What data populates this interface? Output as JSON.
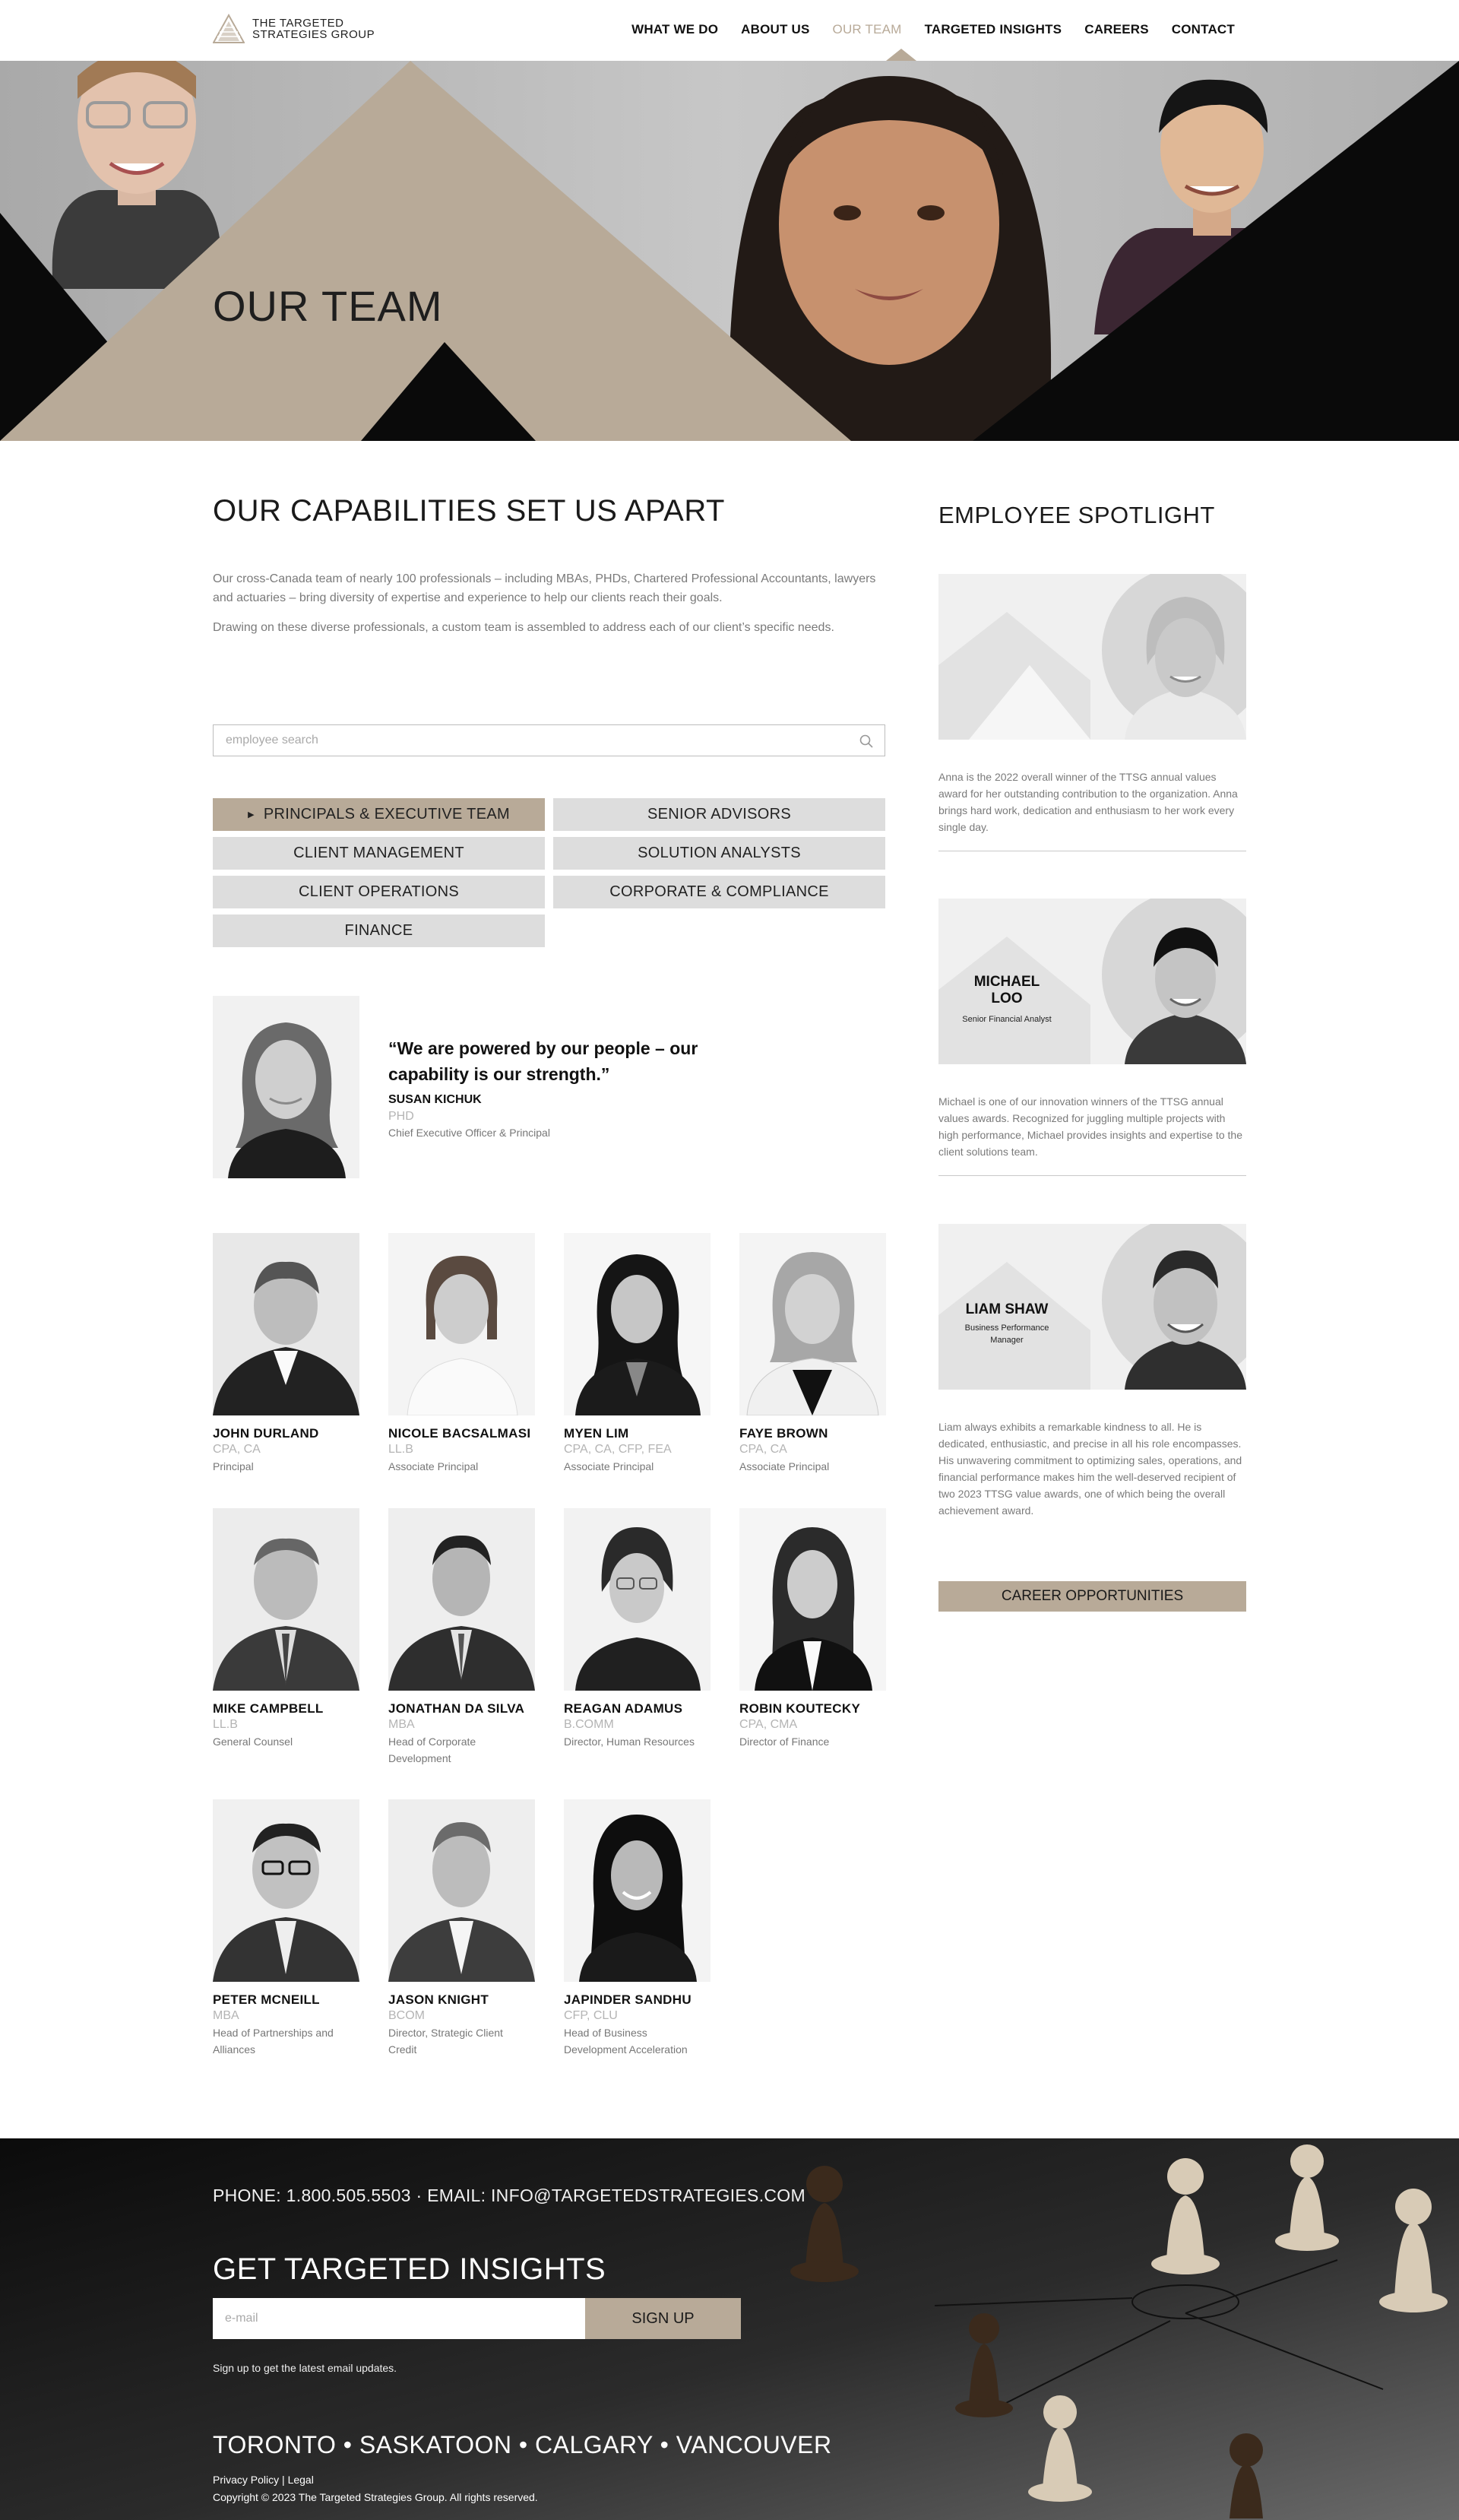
{
  "brand": {
    "name_line1": "THE TARGETED",
    "name_line2": "STRATEGIES GROUP",
    "accent_color": "#b8aa98"
  },
  "nav": {
    "items": [
      {
        "label": "WHAT WE DO",
        "active": false
      },
      {
        "label": "ABOUT US",
        "active": false
      },
      {
        "label": "OUR TEAM",
        "active": true
      },
      {
        "label": "TARGETED INSIGHTS",
        "active": false
      },
      {
        "label": "CAREERS",
        "active": false
      },
      {
        "label": "CONTACT",
        "active": false
      }
    ]
  },
  "hero": {
    "title": "OUR TEAM"
  },
  "main": {
    "title": "OUR CAPABILITIES SET US APART",
    "intro": [
      "Our cross-Canada team of nearly 100 professionals – including MBAs, PHDs, Chartered Professional Accountants, lawyers and actuaries – bring diversity of expertise and experience to help our clients reach their goals.",
      "Drawing on these diverse professionals, a custom team is assembled to address each of our client’s specific needs."
    ],
    "search_placeholder": "employee search",
    "filters": [
      {
        "label": "PRINCIPALS & EXECUTIVE TEAM",
        "active": true
      },
      {
        "label": "SENIOR ADVISORS",
        "active": false
      },
      {
        "label": "CLIENT MANAGEMENT",
        "active": false
      },
      {
        "label": "SOLUTION ANALYSTS",
        "active": false
      },
      {
        "label": "CLIENT OPERATIONS",
        "active": false
      },
      {
        "label": "CORPORATE & COMPLIANCE",
        "active": false
      },
      {
        "label": "FINANCE",
        "active": false
      }
    ],
    "featured": {
      "quote": "“We are powered by our people – our capability is our strength.”",
      "name": "SUSAN KICHUK",
      "credentials": "PHD",
      "role": "Chief Executive Officer & Principal"
    },
    "team": [
      {
        "name": "JOHN DURLAND",
        "credentials": "CPA, CA",
        "role": "Principal"
      },
      {
        "name": "NICOLE BACSALMASI",
        "credentials": "LL.B",
        "role": "Associate Principal"
      },
      {
        "name": "MYEN LIM",
        "credentials": "CPA, CA, CFP, FEA",
        "role": "Associate Principal"
      },
      {
        "name": "FAYE BROWN",
        "credentials": "CPA, CA",
        "role": "Associate Principal"
      },
      {
        "name": "MIKE CAMPBELL",
        "credentials": "LL.B",
        "role": "General Counsel"
      },
      {
        "name": "JONATHAN DA SILVA",
        "credentials": "MBA",
        "role": "Head of Corporate Development"
      },
      {
        "name": "REAGAN ADAMUS",
        "credentials": "B.COMM",
        "role": "Director, Human Resources"
      },
      {
        "name": "ROBIN KOUTECKY",
        "credentials": "CPA, CMA",
        "role": "Director of Finance"
      },
      {
        "name": "PETER MCNEILL",
        "credentials": "MBA",
        "role": "Head of Partnerships and Alliances"
      },
      {
        "name": "JASON KNIGHT",
        "credentials": "BCOM",
        "role": "Director, Strategic Client Credit"
      },
      {
        "name": "JAPINDER SANDHU",
        "credentials": "CFP, CLU",
        "role": "Head of Business Development Acceleration"
      }
    ]
  },
  "sidebar": {
    "title": "EMPLOYEE SPOTLIGHT",
    "spotlights": [
      {
        "card_name": "",
        "card_title": "",
        "text": "Anna is the 2022 overall winner of the TTSG annual values award for her outstanding contribution to the organization. Anna brings hard work, dedication and enthusiasm to her work every single day."
      },
      {
        "card_name": "MICHAEL LOO",
        "card_title": "Senior Financial Analyst",
        "text": "Michael is one of our innovation winners of the TTSG annual values awards. Recognized for juggling multiple projects with high performance, Michael provides insights and expertise to the client solutions team."
      },
      {
        "card_name": "LIAM SHAW",
        "card_title": "Business Performance Manager",
        "text": "Liam always exhibits a remarkable kindness to all. He is dedicated, enthusiastic, and precise in all his role encompasses. His unwavering commitment to optimizing sales, operations, and financial performance makes him the well-deserved recipient of two 2023 TTSG value awards, one of which being the overall achievement award."
      }
    ],
    "career_button": "CAREER OPPORTUNITIES"
  },
  "footer": {
    "contact": "PHONE: 1.800.505.5503 · EMAIL: INFO@TARGETEDSTRATEGIES.COM",
    "insights_title": "GET TARGETED INSIGHTS",
    "email_placeholder": "e-mail",
    "signup_button": "SIGN UP",
    "signup_note": "Sign up to get the latest email updates.",
    "cities": "TORONTO • SASKATOON • CALGARY • VANCOUVER",
    "privacy_link": "Privacy Policy",
    "separator": "|",
    "legal_link": "Legal",
    "copyright": "Copyright © 2023 The Targeted Strategies Group. All rights reserved."
  }
}
